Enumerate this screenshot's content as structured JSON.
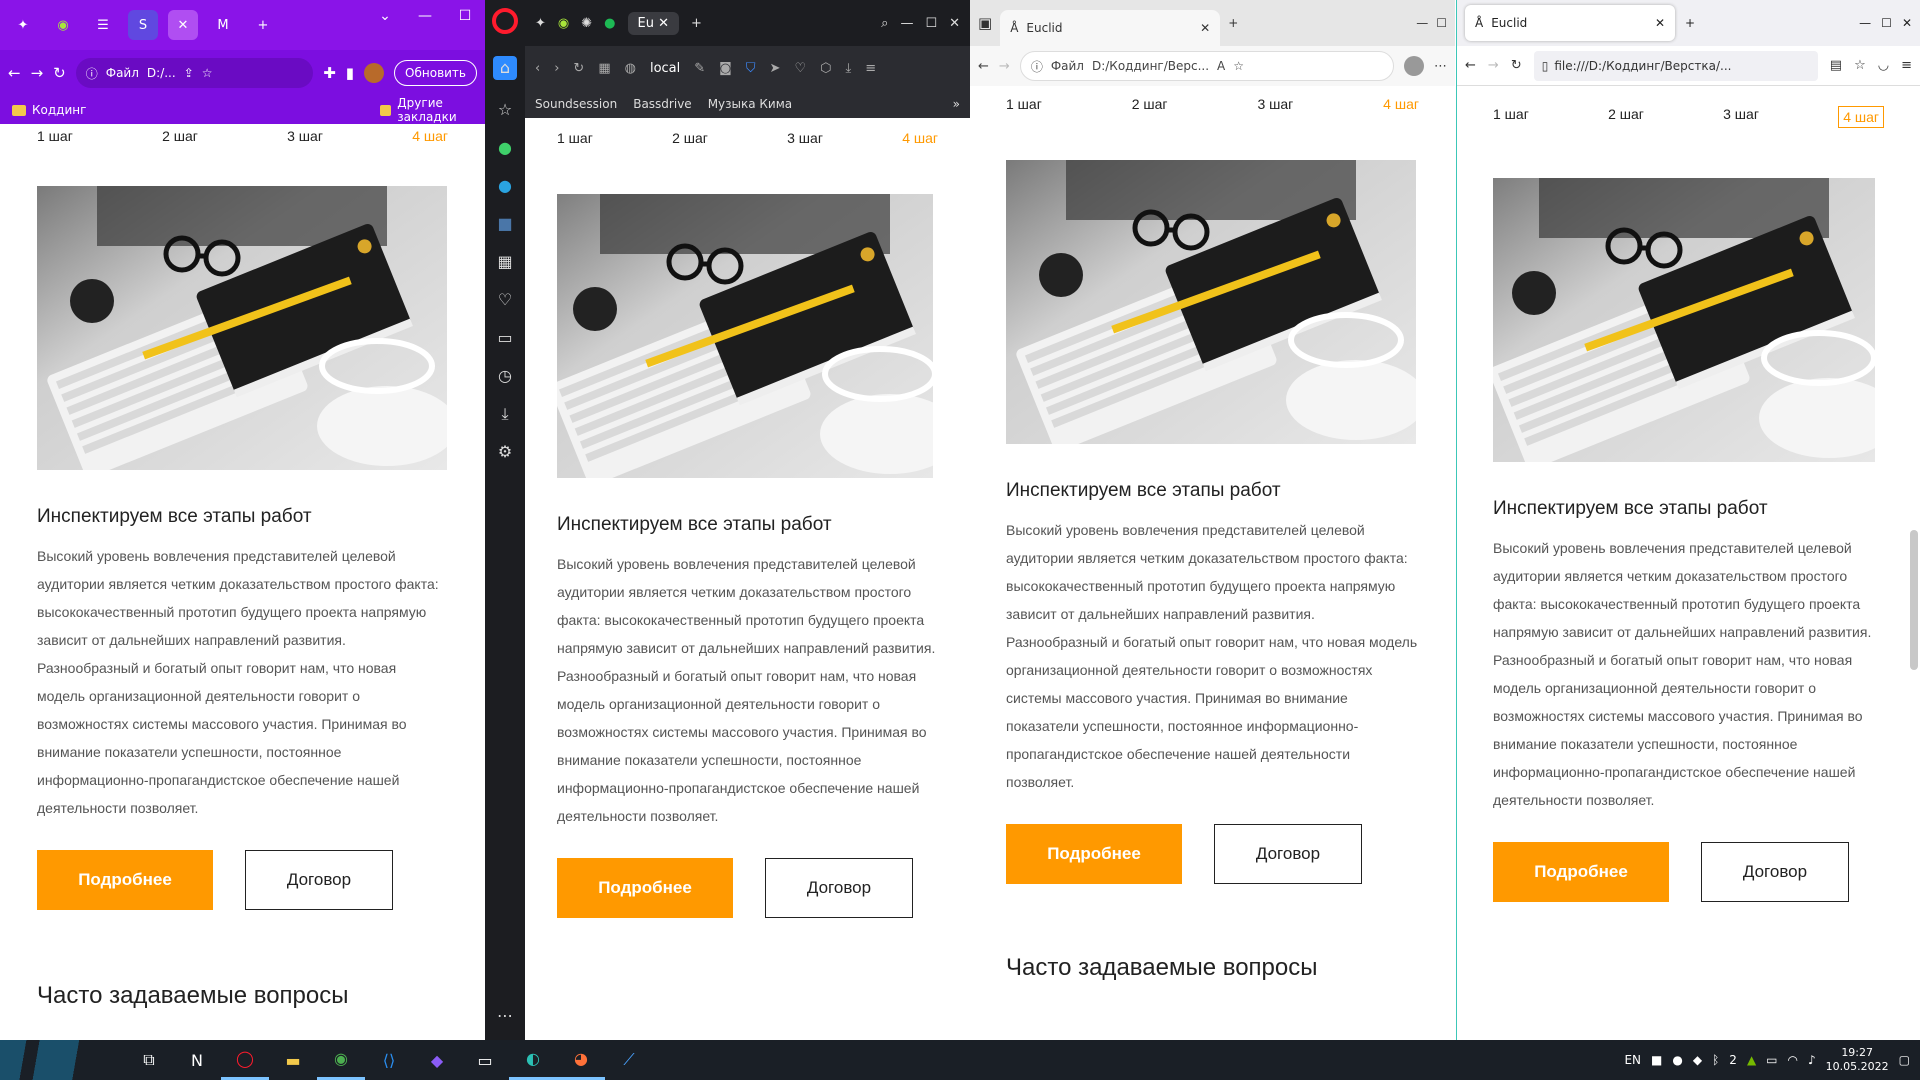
{
  "content": {
    "steps": [
      "1 шаг",
      "2 шаг",
      "3 шаг",
      "4 шаг"
    ],
    "heading": "Инспектируем все этапы работ",
    "paragraph": "Высокий уровень вовлечения представителей целевой аудитории является четким доказательством простого факта: высококачественный прототип будущего проекта напрямую зависит от дальнейших направлений развития. Разнообразный и богатый опыт говорит нам, что новая модель организационной деятельности говорит о возможностях системы массового участия. Принимая во внимание показатели успешности, постоянное информационно-пропагандистское обеспечение нашей деятельности позволяет.",
    "btn_more": "Подробнее",
    "btn_contract": "Договор",
    "faq": "Часто задаваемые вопросы"
  },
  "chrome": {
    "file_label": "Файл",
    "url": "D:/...",
    "update_btn": "Обновить",
    "bookmark_1": "Коддинг",
    "bookmark_2": "Другие закладки"
  },
  "opera": {
    "tab_title": "Eu",
    "address": "local",
    "bookmarks": [
      "Soundsession",
      "Bassdrive",
      "Музыка Кима"
    ]
  },
  "edge": {
    "tab_title": "Euclid",
    "file_label": "Файл",
    "url": "D:/Коддинг/Верс..."
  },
  "firefox": {
    "tab_title": "Euclid",
    "url": "file:///D:/Коддинг/Верстка/..."
  },
  "taskbar": {
    "lang": "EN",
    "time": "19:27",
    "date": "10.05.2022",
    "badge": "2"
  },
  "colors": {
    "accent": "#ff9900",
    "chrome_purple": "#8a14e8",
    "opera_red": "#ff1b2d"
  }
}
